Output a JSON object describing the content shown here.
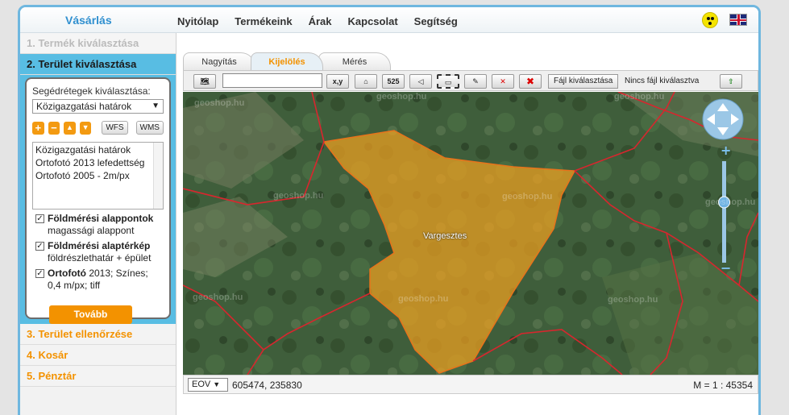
{
  "header": {
    "brand": "Vásárlás",
    "nav": [
      "Nyitólap",
      "Termékeink",
      "Árak",
      "Kapcsolat",
      "Segítség"
    ],
    "accessibility_icon": "accessibility-icon",
    "language_icon": "uk-flag-icon"
  },
  "steps": {
    "s1": "1. Termék kiválasztása",
    "s2": "2. Terület kiválasztása",
    "s3": "3. Terület ellenőrzése",
    "s4": "4. Kosár",
    "s5": "5. Pénztár"
  },
  "panel": {
    "helper_label": "Segédrétegek kiválasztása:",
    "helper_select": "Közigazgatási határok",
    "wfs": "WFS",
    "wms": "WMS",
    "layers": [
      "Közigazgatási határok",
      "Ortofotó 2013 lefedettség",
      "Ortofotó 2005 - 2m/px"
    ],
    "checks": [
      {
        "bold": "Földmérési alappontok",
        "rest": "magassági alappont"
      },
      {
        "bold": "Földmérési alaptérkép",
        "rest": "földrészlethatár + épület"
      },
      {
        "bold": "Ortofotó",
        "rest": " 2013; Színes; 0,4 m/px; tiff"
      }
    ],
    "next_button": "Tovább"
  },
  "tabs": [
    "Nagyítás",
    "Kijelölés",
    "Mérés"
  ],
  "toolbar": {
    "xy_button": "x,y",
    "scale_button": "525",
    "file_button": "Fájl kiválasztása",
    "no_file": "Nincs fájl kiválasztva"
  },
  "map": {
    "place_label": "Vargesztes",
    "watermark": "geoshop.hu",
    "highlight_color": "#f39c12",
    "boundary_color": "#d8262e"
  },
  "statusbar": {
    "projection": "EOV",
    "coordinates": "605474, 235830",
    "scale": "M = 1 : 45354"
  }
}
